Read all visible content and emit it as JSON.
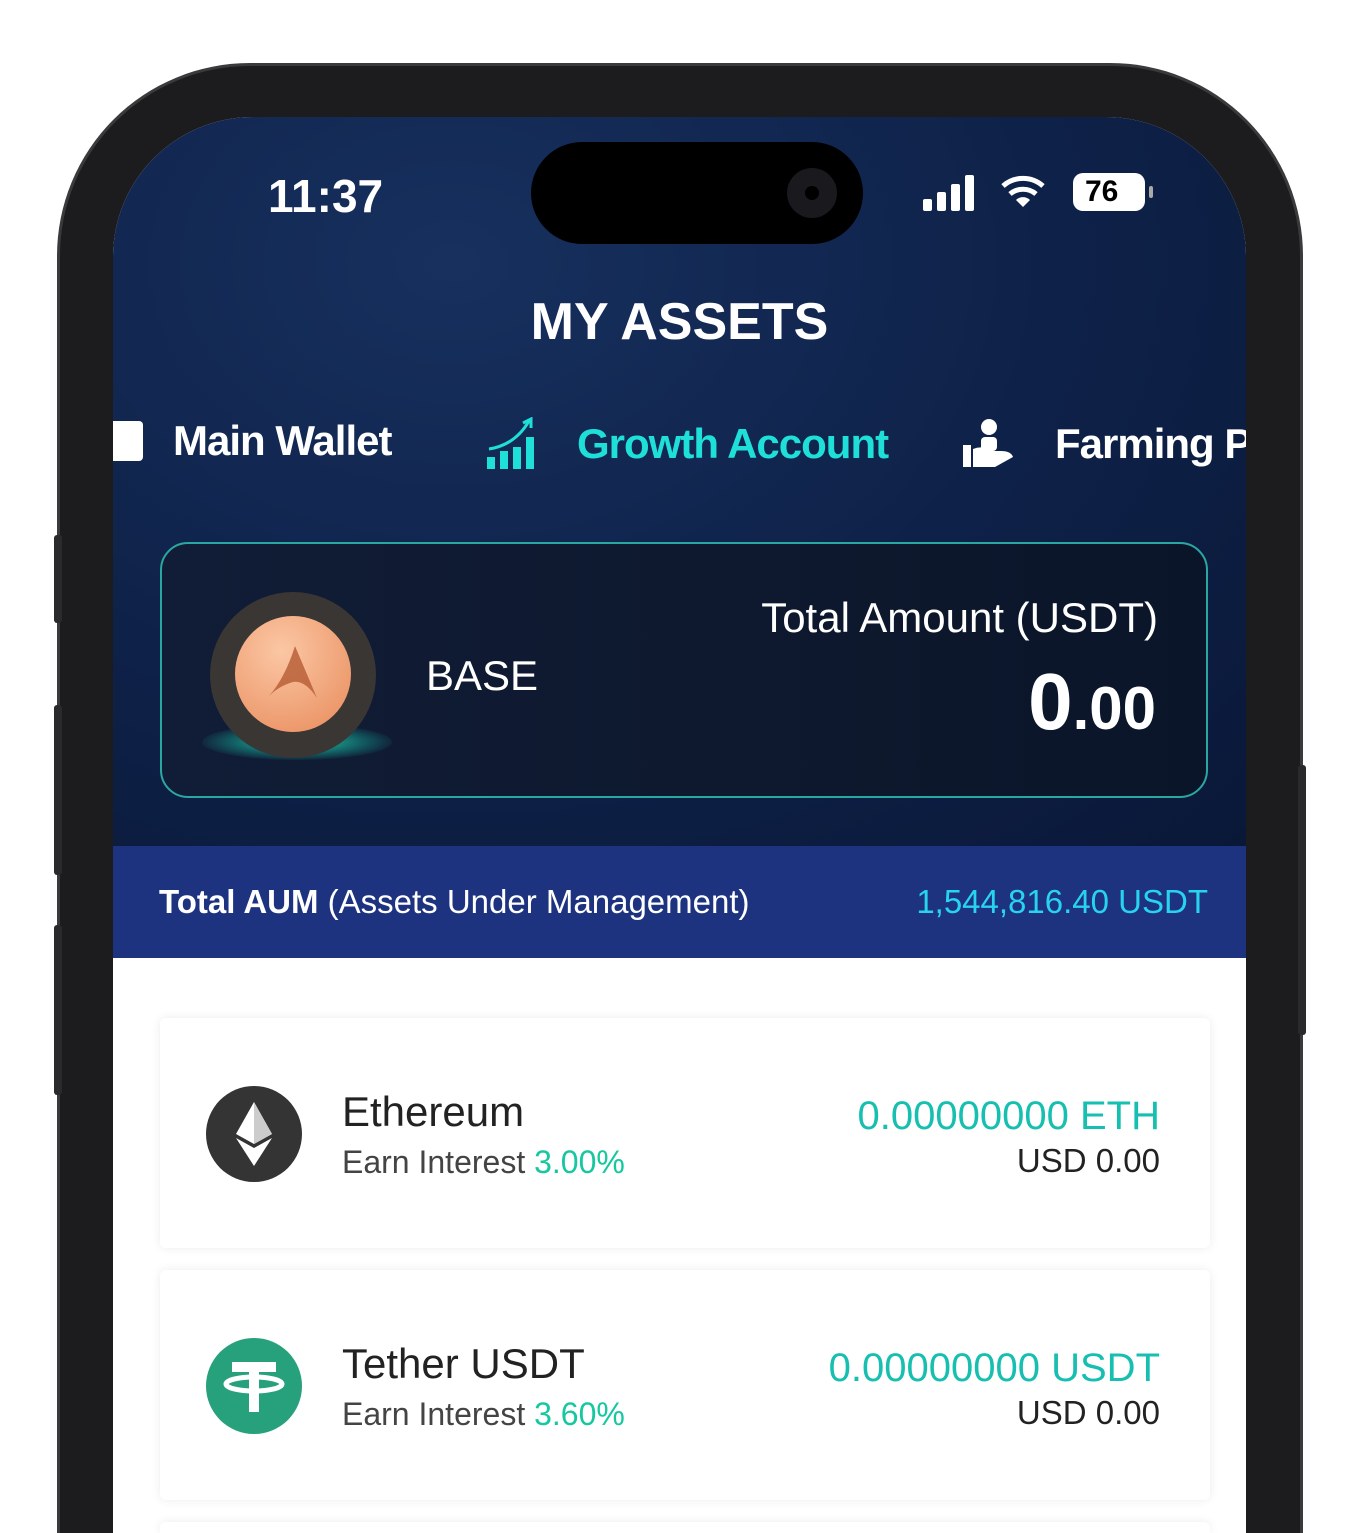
{
  "status_bar": {
    "time": "11:37",
    "battery": "76"
  },
  "header": {
    "title": "MY ASSETS"
  },
  "tabs": [
    {
      "label": "Main Wallet",
      "icon": "wallet-icon",
      "active": false
    },
    {
      "label": "Growth Account",
      "icon": "growth-chart-icon",
      "active": true
    },
    {
      "label": "Farming P",
      "icon": "farming-hand-icon",
      "active": false
    }
  ],
  "account_card": {
    "name": "BASE",
    "total_label": "Total Amount (USDT)",
    "total_int": "0",
    "total_dec": ".00"
  },
  "aum": {
    "label_bold": "Total AUM",
    "label_rest": " (Assets Under Management)",
    "value": "1,544,816.40 USDT"
  },
  "assets": [
    {
      "name": "Ethereum",
      "interest_label": "Earn Interest ",
      "interest": "3.00%",
      "amount": "0.00000000 ETH",
      "usd": "USD 0.00",
      "icon": "ethereum-icon",
      "color": "#343434"
    },
    {
      "name": "Tether USDT",
      "interest_label": "Earn Interest ",
      "interest": "3.60%",
      "amount": "0.00000000 USDT",
      "usd": "USD 0.00",
      "icon": "tether-icon",
      "color": "#26a17b"
    }
  ],
  "colors": {
    "accent": "#1fe0d8",
    "aum_band": "#1d3380",
    "header_bg": "#0e2148"
  }
}
